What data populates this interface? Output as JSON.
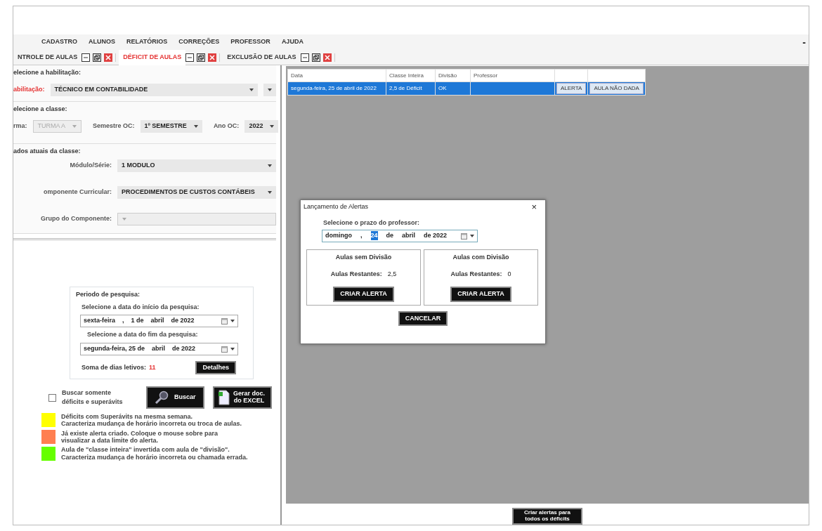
{
  "menu": [
    "CADASTRO",
    "ALUNOS",
    "RELATÓRIOS",
    "CORREÇÕES",
    "PROFESSOR",
    "AJUDA"
  ],
  "window_minimize": "-",
  "tabs": [
    {
      "label": "NTROLE DE AULAS",
      "selected": false
    },
    {
      "label": "DÉFICIT DE AULAS",
      "selected": true
    },
    {
      "label": "EXCLUSÃO DE AULAS",
      "selected": false
    }
  ],
  "left_panel": {
    "habilitacao": {
      "legend": "elecione a habilitação:",
      "label": "abilitação:",
      "value": "TÉCNICO EM CONTABILIDADE"
    },
    "classe": {
      "legend": "elecione a classe:",
      "fields": [
        {
          "label": "rma:",
          "value": "TURMA A",
          "disabled": true
        },
        {
          "label": "Semestre OC:",
          "value": "1º SEMESTRE",
          "disabled": false
        },
        {
          "label": "Ano OC:",
          "value": "2022",
          "disabled": false
        }
      ]
    },
    "dados": {
      "legend": "ados atuais da classe:",
      "fields": [
        {
          "label": "Módulo/Série:",
          "value": "1 MODULO",
          "disabled": false
        },
        {
          "label": "omponente Curricular:",
          "value": "PROCEDIMENTOS DE CUSTOS CONTÁBEIS",
          "disabled": false
        },
        {
          "label": "Grupo do Componente:",
          "disabled": true
        }
      ]
    },
    "periodo": {
      "legend": "Periodo de pesquisa:",
      "start_label": "Selecione a data do início da pesquisa:",
      "start_date": [
        {
          "text": "sexta-feira",
          "selected": false
        },
        {
          "text": ",",
          "selected": false
        },
        {
          "text": "1 de",
          "selected": false
        },
        {
          "text": "abril",
          "selected": false
        },
        {
          "text": "de 2022",
          "selected": false
        }
      ],
      "end_label": "Selecione a data do fim da pesquisa:",
      "end_date": [
        {
          "text": "segunda-feira, 25 de",
          "selected": false
        },
        {
          "text": "abril",
          "selected": false
        },
        {
          "text": "de 2022",
          "selected": false
        }
      ],
      "sum_label": "Soma de dias letivos:",
      "sum_value": "11",
      "details_button": "Detalhes"
    },
    "search": {
      "checkbox_label": "Buscar somente déficits e superávits",
      "checked": false,
      "search_button": "Buscar",
      "excel_button": "Gerar doc. do EXCEL"
    },
    "legend": [
      {
        "color": "#ffff00",
        "lines": [
          "Déficits com Superávits na mesma semana.",
          "Caracteriza mudança de horário incorreta ou troca de aulas."
        ]
      },
      {
        "color": "#ff7f50",
        "lines": [
          "Já existe alerta criado. Coloque o mouse sobre para",
          "visualizar a data limite do alerta."
        ]
      },
      {
        "color": "#66ff00",
        "lines": [
          "Aula de \"classe inteira\" invertida com aula de \"divisão\".",
          "Caracteriza mudança de horário incorreta ou chamada errada."
        ]
      }
    ]
  },
  "table": {
    "columns": [
      "Data",
      "Classe Inteira",
      "Divisão",
      "Professor"
    ],
    "rows": [
      {
        "selected": true,
        "cells": [
          "segunda-feira, 25 de abril de 2022",
          "2,5 de Déficit",
          "OK",
          ""
        ],
        "buttons": [
          "ALERTA",
          "AULA NÃO DADA"
        ]
      }
    ]
  },
  "dialog": {
    "title": "Lançamento de Alertas",
    "close": "×",
    "prompt": "Selecione o prazo do professor:",
    "date": [
      {
        "text": "domingo",
        "selected": false
      },
      {
        "text": ",",
        "selected": false
      },
      {
        "text": "24",
        "selected": true
      },
      {
        "text": "de",
        "selected": false
      },
      {
        "text": "abril",
        "selected": false
      },
      {
        "text": "de 2022",
        "selected": false
      }
    ],
    "groups": [
      {
        "title": "Aulas sem Divisão",
        "label": "Aulas Restantes:",
        "value": "2,5",
        "button": "CRIAR ALERTA"
      },
      {
        "title": "Aulas com Divisão",
        "label": "Aulas Restantes:",
        "value": "0",
        "button": "CRIAR ALERTA"
      }
    ],
    "cancel": "CANCELAR"
  },
  "bottom_button": "Criar alertas para todos os déficits"
}
